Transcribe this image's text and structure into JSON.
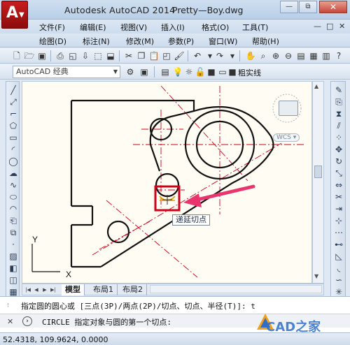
{
  "window": {
    "app_title": "Autodesk AutoCAD 2014",
    "file_name": "Pretty—Boy.dwg",
    "logo_letter": "A",
    "minimize": "—",
    "restore": "⧉",
    "close": "✕"
  },
  "menu_row1": {
    "items": [
      "文件(F)",
      "编辑(E)",
      "视图(V)",
      "插入(I)",
      "格式(O)",
      "工具(T)"
    ],
    "mdi_controls": [
      "—",
      "□",
      "✕"
    ]
  },
  "menu_row2": {
    "items": [
      "绘图(D)",
      "标注(N)",
      "修改(M)",
      "参数(P)",
      "窗口(W)",
      "帮助(H)"
    ]
  },
  "toolbar2": {
    "workspace": "AutoCAD 经典",
    "linetype": "粗实线"
  },
  "canvas": {
    "tooltip": "递延切点",
    "wcs": "WCS",
    "axis_y": "Y",
    "axis_x": "X"
  },
  "tabs": {
    "model": "模型",
    "layout1": "布局1",
    "layout2": "布局2"
  },
  "command": {
    "history": "指定圆的圆心或 [三点(3P)/两点(2P)/切点、切点、半径(T)]: t",
    "prompt": "CIRCLE 指定对象与圆的第一个切点:"
  },
  "status": {
    "coordinates": "52.4318, 109.9624, 0.0000"
  },
  "watermark": "CAD之家",
  "colors": {
    "accent_red": "#d0021b",
    "arrow_pink": "#e8356e",
    "canvas_bg": "#fefcf3",
    "tangent_marker": "#e6a10a"
  },
  "icons": {
    "toolbar1": [
      "new-icon",
      "open-icon",
      "save-icon",
      "print-icon",
      "preview-icon",
      "publish-icon",
      "cut-icon",
      "copy-icon",
      "paste-icon",
      "match-icon",
      "brush-icon",
      "undo-icon",
      "redo-icon",
      "pan-icon",
      "zoom-realtime-icon",
      "zoom-window-icon",
      "zoom-previous-icon",
      "properties-icon",
      "design-center-icon",
      "tool-palette-icon",
      "sheet-icon",
      "markup-icon",
      "calculator-icon",
      "help-icon"
    ],
    "left": [
      "line-icon",
      "construction-line-icon",
      "polyline-icon",
      "polygon-icon",
      "rectangle-icon",
      "arc-icon",
      "circle-icon",
      "revcloud-icon",
      "spline-icon",
      "ellipse-icon",
      "ellipse-arc-icon",
      "insert-block-icon",
      "make-block-icon",
      "point-icon",
      "hatch-icon",
      "gradient-icon",
      "region-icon",
      "table-icon",
      "mtext-icon"
    ],
    "right": [
      "erase-icon",
      "copy-object-icon",
      "mirror-icon",
      "offset-icon",
      "array-icon",
      "move-icon",
      "rotate-icon",
      "scale-icon",
      "stretch-icon",
      "trim-icon",
      "extend-icon",
      "break-point-icon",
      "break-icon",
      "join-icon",
      "chamfer-icon",
      "fillet-icon",
      "blend-icon",
      "explode-icon"
    ]
  }
}
